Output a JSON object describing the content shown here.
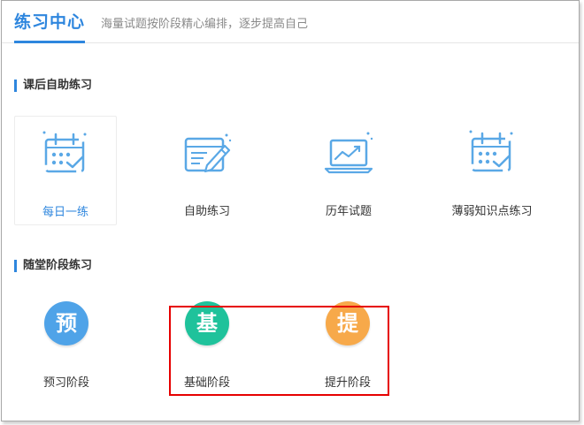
{
  "header": {
    "title": "练习中心",
    "subtitle": "海量试题按阶段精心编排，逐步提高自己"
  },
  "sections": {
    "self_practice": {
      "title": "课后自助练习",
      "items": [
        {
          "label": "每日一练",
          "icon": "calendar-check-icon",
          "active": true
        },
        {
          "label": "自助练习",
          "icon": "calendar-pencil-icon",
          "active": false
        },
        {
          "label": "历年试题",
          "icon": "laptop-chart-icon",
          "active": false
        },
        {
          "label": "薄弱知识点练习",
          "icon": "calendar-check-icon",
          "active": false
        }
      ]
    },
    "stage_practice": {
      "title": "随堂阶段练习",
      "items": [
        {
          "label": "预习阶段",
          "badge": "预",
          "color": "#4fa3e8"
        },
        {
          "label": "基础阶段",
          "badge": "基",
          "color": "#1fc29b"
        },
        {
          "label": "提升阶段",
          "badge": "提",
          "color": "#f7a94a"
        }
      ]
    }
  },
  "colors": {
    "accent": "#2e86de",
    "icon": "#5aa8e6",
    "highlight": "#e60000"
  }
}
